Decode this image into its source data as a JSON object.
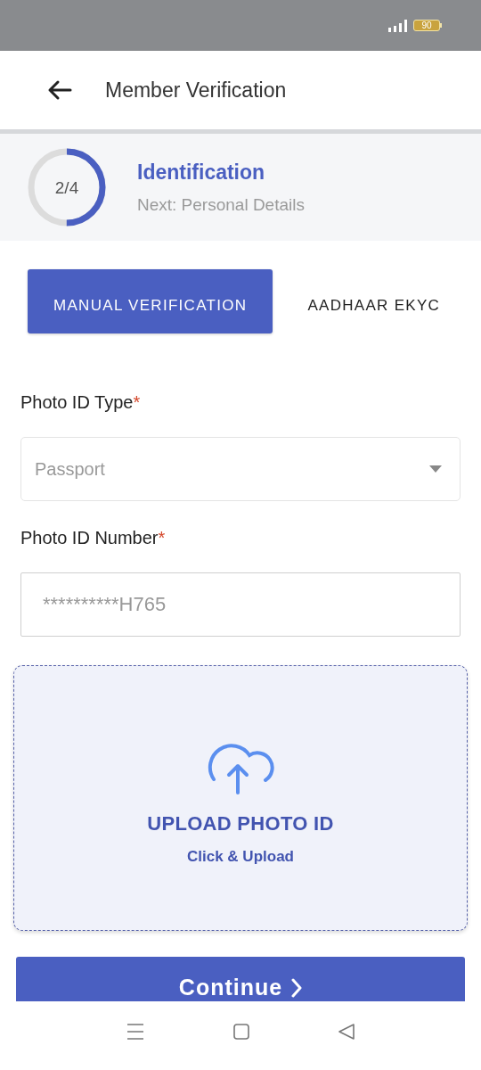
{
  "status_bar": {
    "battery": "90"
  },
  "header": {
    "title": "Member Verification"
  },
  "progress": {
    "step": "2/4",
    "level": 0.5,
    "title": "Identification",
    "next": "Next: Personal Details"
  },
  "tabs": [
    {
      "label": "MANUAL VERIFICATION",
      "selected": true
    },
    {
      "label": "AADHAAR EKYC",
      "selected": false
    }
  ],
  "fields": [
    {
      "kind": "select",
      "label": "Photo ID Type",
      "required_mark": "*",
      "value": "Passport"
    },
    {
      "kind": "text",
      "label": "Photo ID Number",
      "required_mark": "*",
      "value": "**********H765"
    }
  ],
  "upload": {
    "title": "UPLOAD PHOTO ID",
    "subtitle": "Click & Upload"
  },
  "continue_button": {
    "label": "Continue"
  }
}
